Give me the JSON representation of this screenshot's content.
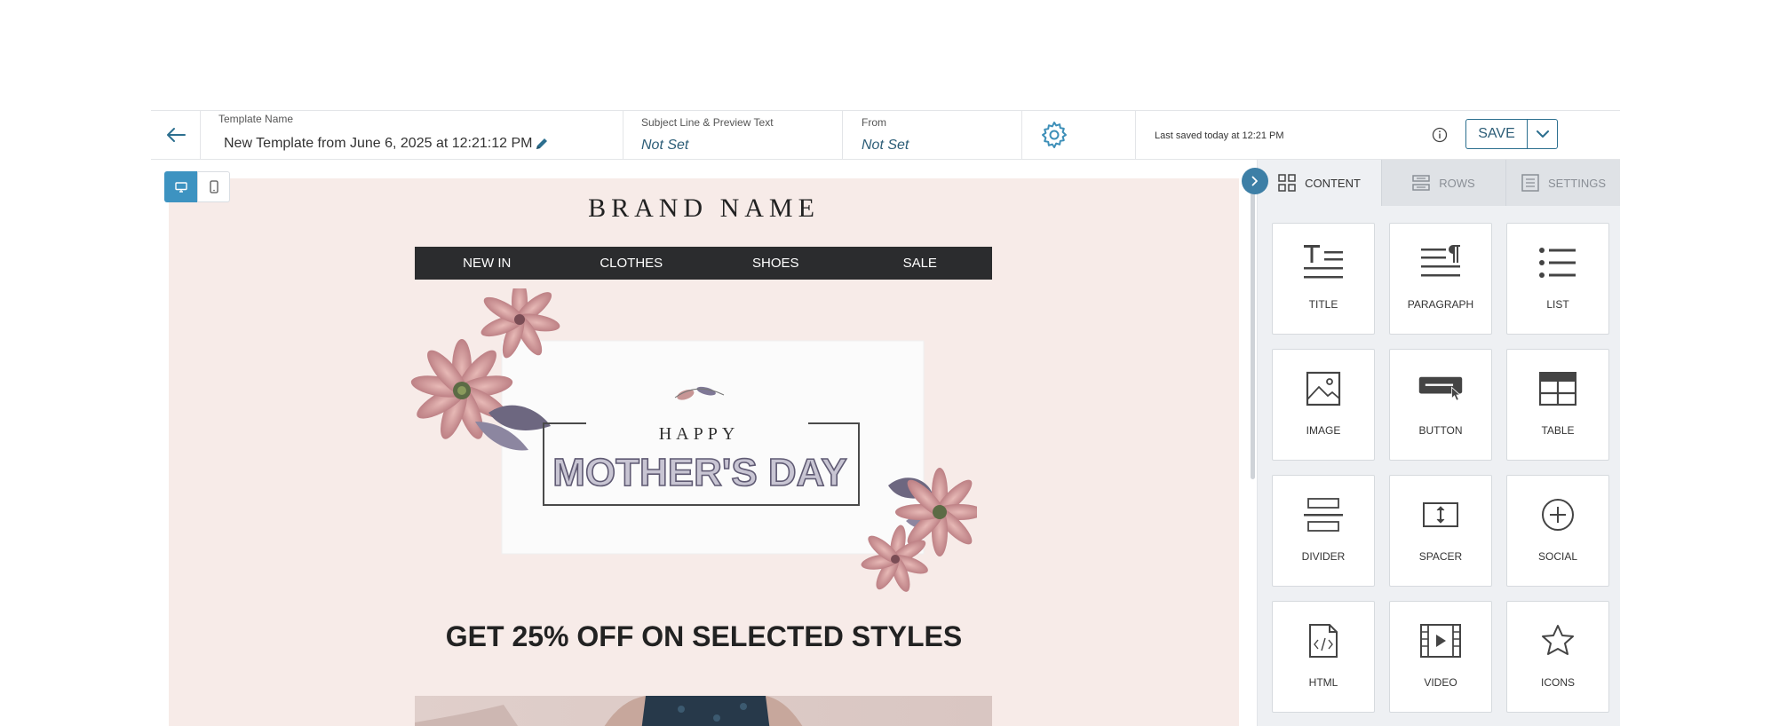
{
  "topbar": {
    "template_name_label": "Template Name",
    "template_name_value": "New Template from June 6, 2025 at 12:21:12 PM",
    "subject_label": "Subject Line & Preview Text",
    "subject_value": "Not Set",
    "from_label": "From",
    "from_value": "Not Set",
    "last_saved": "Last saved today at 12:21 PM",
    "save_label": "SAVE"
  },
  "email": {
    "brand": "BRAND NAME",
    "nav": [
      "NEW IN",
      "CLOTHES",
      "SHOES",
      "SALE"
    ],
    "hero_small": "HAPPY",
    "hero_big": "MOTHER'S DAY",
    "headline": "GET 25% OFF ON SELECTED STYLES"
  },
  "panel": {
    "tabs": [
      "CONTENT",
      "ROWS",
      "SETTINGS"
    ],
    "active_tab": "CONTENT",
    "blocks": [
      {
        "label": "TITLE",
        "icon": "title-icon"
      },
      {
        "label": "PARAGRAPH",
        "icon": "paragraph-icon"
      },
      {
        "label": "LIST",
        "icon": "list-icon"
      },
      {
        "label": "IMAGE",
        "icon": "image-icon"
      },
      {
        "label": "BUTTON",
        "icon": "button-icon"
      },
      {
        "label": "TABLE",
        "icon": "table-icon"
      },
      {
        "label": "DIVIDER",
        "icon": "divider-icon"
      },
      {
        "label": "SPACER",
        "icon": "spacer-icon"
      },
      {
        "label": "SOCIAL",
        "icon": "social-icon"
      },
      {
        "label": "HTML",
        "icon": "html-icon"
      },
      {
        "label": "VIDEO",
        "icon": "video-icon"
      },
      {
        "label": "ICONS",
        "icon": "icons-icon"
      }
    ]
  },
  "colors": {
    "accent": "#3d93c1",
    "canvas_bg": "#f7ebe8",
    "nav_bg": "#2b2c2e",
    "link_text": "#2c5d77"
  }
}
